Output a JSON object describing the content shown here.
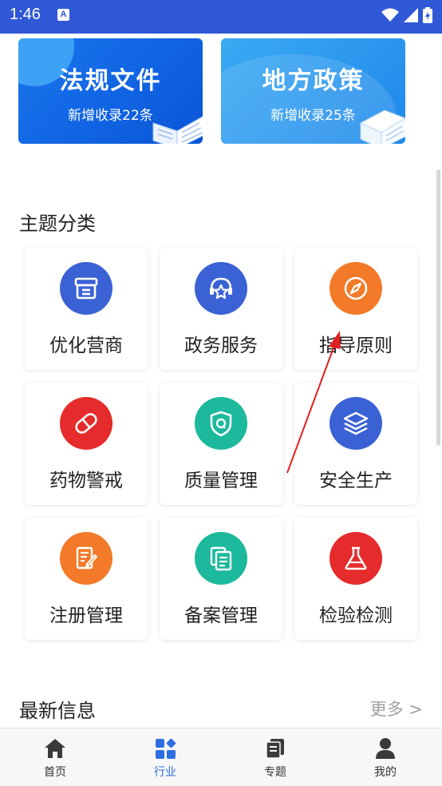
{
  "status_bar": {
    "time": "1:46",
    "notification_letter": "A"
  },
  "banners": [
    {
      "title": "法规文件",
      "subtitle": "新增收录22条"
    },
    {
      "title": "地方政策",
      "subtitle": "新增收录25条"
    }
  ],
  "themes_section": {
    "title": "主题分类"
  },
  "categories": [
    {
      "label": "优化营商",
      "icon": "archive-box-icon",
      "color": "#3a62d4"
    },
    {
      "label": "政务服务",
      "icon": "headset-star-icon",
      "color": "#3a62d4"
    },
    {
      "label": "指导原则",
      "icon": "compass-icon",
      "color": "#f27a28"
    },
    {
      "label": "药物警戒",
      "icon": "pill-icon",
      "color": "#e52b2b"
    },
    {
      "label": "质量管理",
      "icon": "shield-q-icon",
      "color": "#1cb99c"
    },
    {
      "label": "安全生产",
      "icon": "layers-icon",
      "color": "#3a62d4"
    },
    {
      "label": "注册管理",
      "icon": "document-edit-icon",
      "color": "#f27a28"
    },
    {
      "label": "备案管理",
      "icon": "copy-document-icon",
      "color": "#1cb99c"
    },
    {
      "label": "检验检测",
      "icon": "flask-icon",
      "color": "#e52b2b"
    }
  ],
  "news_section": {
    "title": "最新信息",
    "more_label": "更多 >"
  },
  "tabbar": {
    "active_color": "#2f6ee0",
    "items": [
      {
        "label": "首页",
        "icon": "home-icon"
      },
      {
        "label": "行业",
        "icon": "grid-apps-icon"
      },
      {
        "label": "专题",
        "icon": "topics-stack-icon"
      },
      {
        "label": "我的",
        "icon": "person-icon"
      }
    ]
  }
}
